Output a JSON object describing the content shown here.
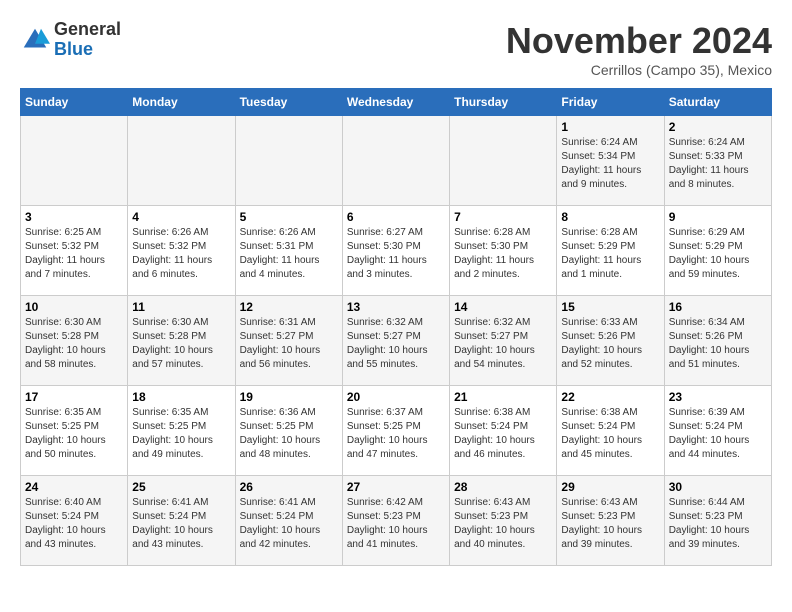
{
  "logo": {
    "general": "General",
    "blue": "Blue"
  },
  "header": {
    "title": "November 2024",
    "subtitle": "Cerrillos (Campo 35), Mexico"
  },
  "weekdays": [
    "Sunday",
    "Monday",
    "Tuesday",
    "Wednesday",
    "Thursday",
    "Friday",
    "Saturday"
  ],
  "weeks": [
    [
      {
        "day": "",
        "info": ""
      },
      {
        "day": "",
        "info": ""
      },
      {
        "day": "",
        "info": ""
      },
      {
        "day": "",
        "info": ""
      },
      {
        "day": "",
        "info": ""
      },
      {
        "day": "1",
        "info": "Sunrise: 6:24 AM\nSunset: 5:34 PM\nDaylight: 11 hours and 9 minutes."
      },
      {
        "day": "2",
        "info": "Sunrise: 6:24 AM\nSunset: 5:33 PM\nDaylight: 11 hours and 8 minutes."
      }
    ],
    [
      {
        "day": "3",
        "info": "Sunrise: 6:25 AM\nSunset: 5:32 PM\nDaylight: 11 hours and 7 minutes."
      },
      {
        "day": "4",
        "info": "Sunrise: 6:26 AM\nSunset: 5:32 PM\nDaylight: 11 hours and 6 minutes."
      },
      {
        "day": "5",
        "info": "Sunrise: 6:26 AM\nSunset: 5:31 PM\nDaylight: 11 hours and 4 minutes."
      },
      {
        "day": "6",
        "info": "Sunrise: 6:27 AM\nSunset: 5:30 PM\nDaylight: 11 hours and 3 minutes."
      },
      {
        "day": "7",
        "info": "Sunrise: 6:28 AM\nSunset: 5:30 PM\nDaylight: 11 hours and 2 minutes."
      },
      {
        "day": "8",
        "info": "Sunrise: 6:28 AM\nSunset: 5:29 PM\nDaylight: 11 hours and 1 minute."
      },
      {
        "day": "9",
        "info": "Sunrise: 6:29 AM\nSunset: 5:29 PM\nDaylight: 10 hours and 59 minutes."
      }
    ],
    [
      {
        "day": "10",
        "info": "Sunrise: 6:30 AM\nSunset: 5:28 PM\nDaylight: 10 hours and 58 minutes."
      },
      {
        "day": "11",
        "info": "Sunrise: 6:30 AM\nSunset: 5:28 PM\nDaylight: 10 hours and 57 minutes."
      },
      {
        "day": "12",
        "info": "Sunrise: 6:31 AM\nSunset: 5:27 PM\nDaylight: 10 hours and 56 minutes."
      },
      {
        "day": "13",
        "info": "Sunrise: 6:32 AM\nSunset: 5:27 PM\nDaylight: 10 hours and 55 minutes."
      },
      {
        "day": "14",
        "info": "Sunrise: 6:32 AM\nSunset: 5:27 PM\nDaylight: 10 hours and 54 minutes."
      },
      {
        "day": "15",
        "info": "Sunrise: 6:33 AM\nSunset: 5:26 PM\nDaylight: 10 hours and 52 minutes."
      },
      {
        "day": "16",
        "info": "Sunrise: 6:34 AM\nSunset: 5:26 PM\nDaylight: 10 hours and 51 minutes."
      }
    ],
    [
      {
        "day": "17",
        "info": "Sunrise: 6:35 AM\nSunset: 5:25 PM\nDaylight: 10 hours and 50 minutes."
      },
      {
        "day": "18",
        "info": "Sunrise: 6:35 AM\nSunset: 5:25 PM\nDaylight: 10 hours and 49 minutes."
      },
      {
        "day": "19",
        "info": "Sunrise: 6:36 AM\nSunset: 5:25 PM\nDaylight: 10 hours and 48 minutes."
      },
      {
        "day": "20",
        "info": "Sunrise: 6:37 AM\nSunset: 5:25 PM\nDaylight: 10 hours and 47 minutes."
      },
      {
        "day": "21",
        "info": "Sunrise: 6:38 AM\nSunset: 5:24 PM\nDaylight: 10 hours and 46 minutes."
      },
      {
        "day": "22",
        "info": "Sunrise: 6:38 AM\nSunset: 5:24 PM\nDaylight: 10 hours and 45 minutes."
      },
      {
        "day": "23",
        "info": "Sunrise: 6:39 AM\nSunset: 5:24 PM\nDaylight: 10 hours and 44 minutes."
      }
    ],
    [
      {
        "day": "24",
        "info": "Sunrise: 6:40 AM\nSunset: 5:24 PM\nDaylight: 10 hours and 43 minutes."
      },
      {
        "day": "25",
        "info": "Sunrise: 6:41 AM\nSunset: 5:24 PM\nDaylight: 10 hours and 43 minutes."
      },
      {
        "day": "26",
        "info": "Sunrise: 6:41 AM\nSunset: 5:24 PM\nDaylight: 10 hours and 42 minutes."
      },
      {
        "day": "27",
        "info": "Sunrise: 6:42 AM\nSunset: 5:23 PM\nDaylight: 10 hours and 41 minutes."
      },
      {
        "day": "28",
        "info": "Sunrise: 6:43 AM\nSunset: 5:23 PM\nDaylight: 10 hours and 40 minutes."
      },
      {
        "day": "29",
        "info": "Sunrise: 6:43 AM\nSunset: 5:23 PM\nDaylight: 10 hours and 39 minutes."
      },
      {
        "day": "30",
        "info": "Sunrise: 6:44 AM\nSunset: 5:23 PM\nDaylight: 10 hours and 39 minutes."
      }
    ]
  ]
}
